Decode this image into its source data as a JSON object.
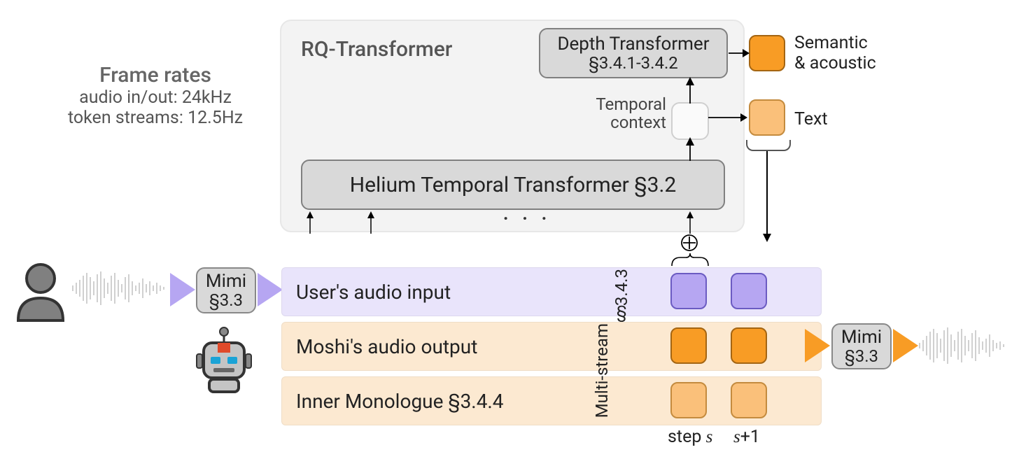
{
  "frame_rates": {
    "title": "Frame rates",
    "line1": "audio in/out: 24kHz",
    "line2": "token streams: 12.5Hz"
  },
  "rq": {
    "title": "RQ-Transformer",
    "helium": "Helium Temporal Transformer §3.2",
    "depth_line1": "Depth Transformer",
    "depth_line2": "§3.4.1-3.4.2",
    "temporal_label": "Temporal\ncontext"
  },
  "mimi": {
    "name": "Mimi",
    "ref": "§3.3"
  },
  "streams": {
    "user": "User's audio input",
    "audio_out": "Moshi's audio output",
    "inner": "Inner Monologue §3.4.4",
    "multistream": "Multi-stream",
    "multistream_ref": "§3.4.3"
  },
  "outputs": {
    "semantic": "Semantic\n& acoustic",
    "text": "Text"
  },
  "steps": {
    "s": "step s",
    "s1": "s+1"
  },
  "colors": {
    "purple": "#b6a6f2",
    "orange": "#f89c25",
    "peach": "#fac07a",
    "grey": "#d9d9d9"
  }
}
